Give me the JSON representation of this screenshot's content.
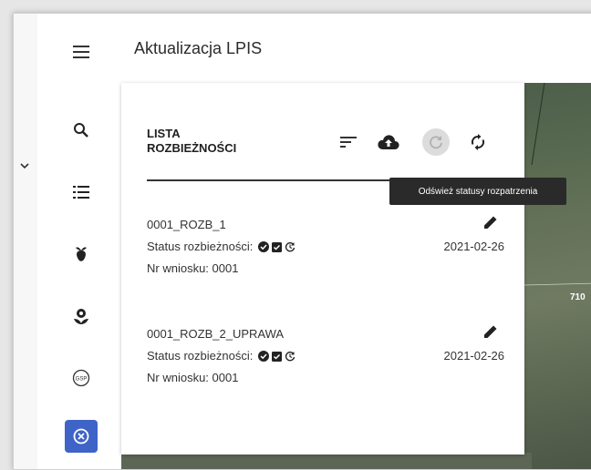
{
  "header": {
    "title": "Aktualizacja LPIS"
  },
  "rail": {
    "items": [
      {
        "icon": "menu-icon"
      },
      {
        "icon": "search-icon"
      },
      {
        "icon": "list-icon"
      },
      {
        "icon": "plant-icon"
      },
      {
        "icon": "seedling-icon"
      },
      {
        "icon": "gsp-icon"
      },
      {
        "icon": "close-circle-icon"
      }
    ],
    "gsp_label": "GSP"
  },
  "panel": {
    "title_line1": "LISTA",
    "title_line2": "ROZBIEŻNOŚCI",
    "tools": [
      "sort-icon",
      "cloud-upload-icon",
      "refresh-icon",
      "sync-icon"
    ],
    "items": [
      {
        "name": "0001_ROZB_1",
        "status_label": "Status rozbieżności:",
        "request_label": "Nr wniosku: 0001",
        "date": "2021-02-26"
      },
      {
        "name": "0001_ROZB_2_UPRAWA",
        "status_label": "Status rozbieżności:",
        "request_label": "Nr wniosku: 0001",
        "date": "2021-02-26"
      }
    ]
  },
  "tooltip": {
    "text": "Odśwież statusy rozpatrzenia"
  },
  "map": {
    "label": "710"
  },
  "colors": {
    "accent": "#3f64c8",
    "tooltip_bg": "#2a2a2a",
    "text": "#333333"
  }
}
